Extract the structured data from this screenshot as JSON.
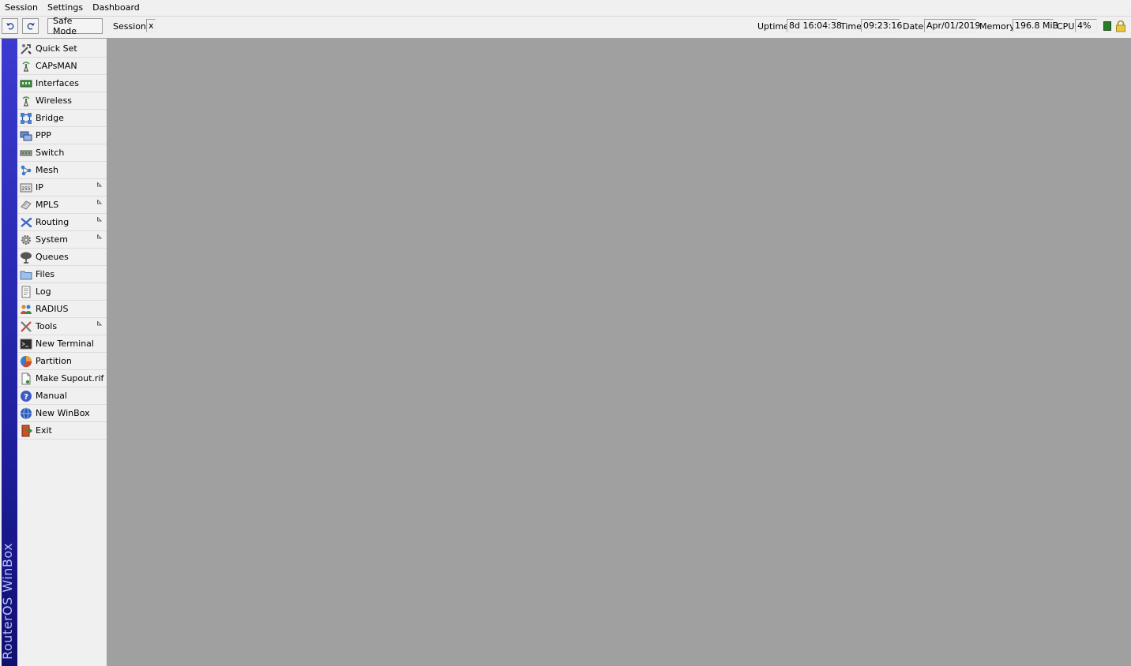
{
  "menubar": {
    "items": [
      "Session",
      "Settings",
      "Dashboard"
    ]
  },
  "toolbar": {
    "undo_icon": "undo-icon",
    "redo_icon": "redo-icon",
    "safe_mode": "Safe Mode",
    "session_label": "Session:",
    "session_value": "x",
    "uptime_label": "Uptime:",
    "uptime_value": "8d 16:04:38",
    "time_label": "Time:",
    "time_value": "09:23:16",
    "date_label": "Date:",
    "date_value": "Apr/01/2019",
    "memory_label": "Memory:",
    "memory_value": "196.8 MiB",
    "cpu_label": "CPU:",
    "cpu_value": "4%"
  },
  "brand": {
    "text": "RouterOS WinBox"
  },
  "sidebar": {
    "items": [
      {
        "label": "Quick Set",
        "icon": "quick-set-icon",
        "submenu": false
      },
      {
        "label": "CAPsMAN",
        "icon": "antenna-icon",
        "submenu": false
      },
      {
        "label": "Interfaces",
        "icon": "interfaces-icon",
        "submenu": false
      },
      {
        "label": "Wireless",
        "icon": "antenna-icon",
        "submenu": false
      },
      {
        "label": "Bridge",
        "icon": "bridge-icon",
        "submenu": false
      },
      {
        "label": "PPP",
        "icon": "ppp-icon",
        "submenu": false
      },
      {
        "label": "Switch",
        "icon": "switch-icon",
        "submenu": false
      },
      {
        "label": "Mesh",
        "icon": "mesh-icon",
        "submenu": false
      },
      {
        "label": "IP",
        "icon": "ip-icon",
        "submenu": true
      },
      {
        "label": "MPLS",
        "icon": "mpls-icon",
        "submenu": true
      },
      {
        "label": "Routing",
        "icon": "routing-icon",
        "submenu": true
      },
      {
        "label": "System",
        "icon": "gear-icon",
        "submenu": true
      },
      {
        "label": "Queues",
        "icon": "queues-icon",
        "submenu": false
      },
      {
        "label": "Files",
        "icon": "folder-icon",
        "submenu": false
      },
      {
        "label": "Log",
        "icon": "log-icon",
        "submenu": false
      },
      {
        "label": "RADIUS",
        "icon": "users-icon",
        "submenu": false
      },
      {
        "label": "Tools",
        "icon": "tools-icon",
        "submenu": true
      },
      {
        "label": "New Terminal",
        "icon": "terminal-icon",
        "submenu": false
      },
      {
        "label": "Partition",
        "icon": "pie-chart-icon",
        "submenu": false
      },
      {
        "label": "Make Supout.rif",
        "icon": "document-icon",
        "submenu": false
      },
      {
        "label": "Manual",
        "icon": "help-icon",
        "submenu": false
      },
      {
        "label": "New WinBox",
        "icon": "globe-icon",
        "submenu": false
      },
      {
        "label": "Exit",
        "icon": "exit-icon",
        "submenu": false
      }
    ]
  },
  "colors": {
    "workspace": "#a0a0a0",
    "brand_bar": "#2a2ab8",
    "status_indicator": "#2c7a2c"
  }
}
